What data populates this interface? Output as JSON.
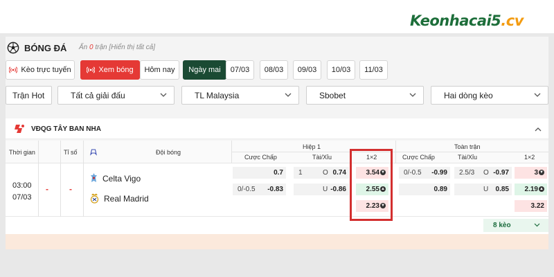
{
  "brand": {
    "logo_main": "Keonhacai5",
    "logo_tld": ".cv"
  },
  "section": {
    "title": "BÓNG ĐÁ",
    "hidden_prefix": "Ẩn ",
    "hidden_count": "0",
    "hidden_suffix": " trận [Hiển thị tất cả]"
  },
  "filters": [
    {
      "label": "Kèo trực tuyến"
    },
    {
      "label": "Xem bóng"
    },
    {
      "label": "Hôm nay"
    },
    {
      "label": "Ngày mai"
    },
    {
      "label": "07/03"
    },
    {
      "label": "08/03"
    },
    {
      "label": "09/03"
    },
    {
      "label": "10/03"
    },
    {
      "label": "11/03"
    }
  ],
  "selects": {
    "hot": "Trận Hot",
    "league": "Tất cả giải đấu",
    "timezone": "TL Malaysia",
    "bookmaker": "Sbobet",
    "lines": "Hai dòng kèo"
  },
  "league": {
    "name": "VĐQG TÂY BAN NHA"
  },
  "table_header": {
    "time": "Thời gian",
    "score": "Tỉ số",
    "teams": "Đội bóng",
    "half": "Hiệp 1",
    "full": "Toàn trận",
    "handicap": "Cược Chấp",
    "over_under": "Tài/Xỉu",
    "one_x_two": "1×2"
  },
  "match": {
    "time": "03:00",
    "date": "07/03",
    "score_a": "-",
    "score_b": "-",
    "home": "Celta Vigo",
    "away": "Real Madrid",
    "half": {
      "handicap": [
        {
          "line": "",
          "odd": "0.7"
        },
        {
          "line": "0/-0.5",
          "odd": "-0.83"
        }
      ],
      "over_under": [
        {
          "line": "1",
          "side": "O",
          "odd": "0.74"
        },
        {
          "line": "",
          "side": "U",
          "odd": "-0.86"
        }
      ],
      "one_x_two": [
        "3.54",
        "2.55",
        "2.23"
      ]
    },
    "full": {
      "handicap": [
        {
          "line": "0/-0.5",
          "odd": "-0.99"
        },
        {
          "line": "",
          "odd": "0.89"
        }
      ],
      "over_under": [
        {
          "line": "2.5/3",
          "side": "O",
          "odd": "-0.97"
        },
        {
          "line": "",
          "side": "U",
          "odd": "0.85"
        }
      ],
      "one_x_two": [
        "3",
        "2.19",
        "3.22"
      ]
    }
  },
  "more": {
    "label": "8 kèo"
  },
  "colors": {
    "accent_red": "#e53935",
    "dark_green": "#1a4a33",
    "highlight_box": "#d32f2f"
  }
}
